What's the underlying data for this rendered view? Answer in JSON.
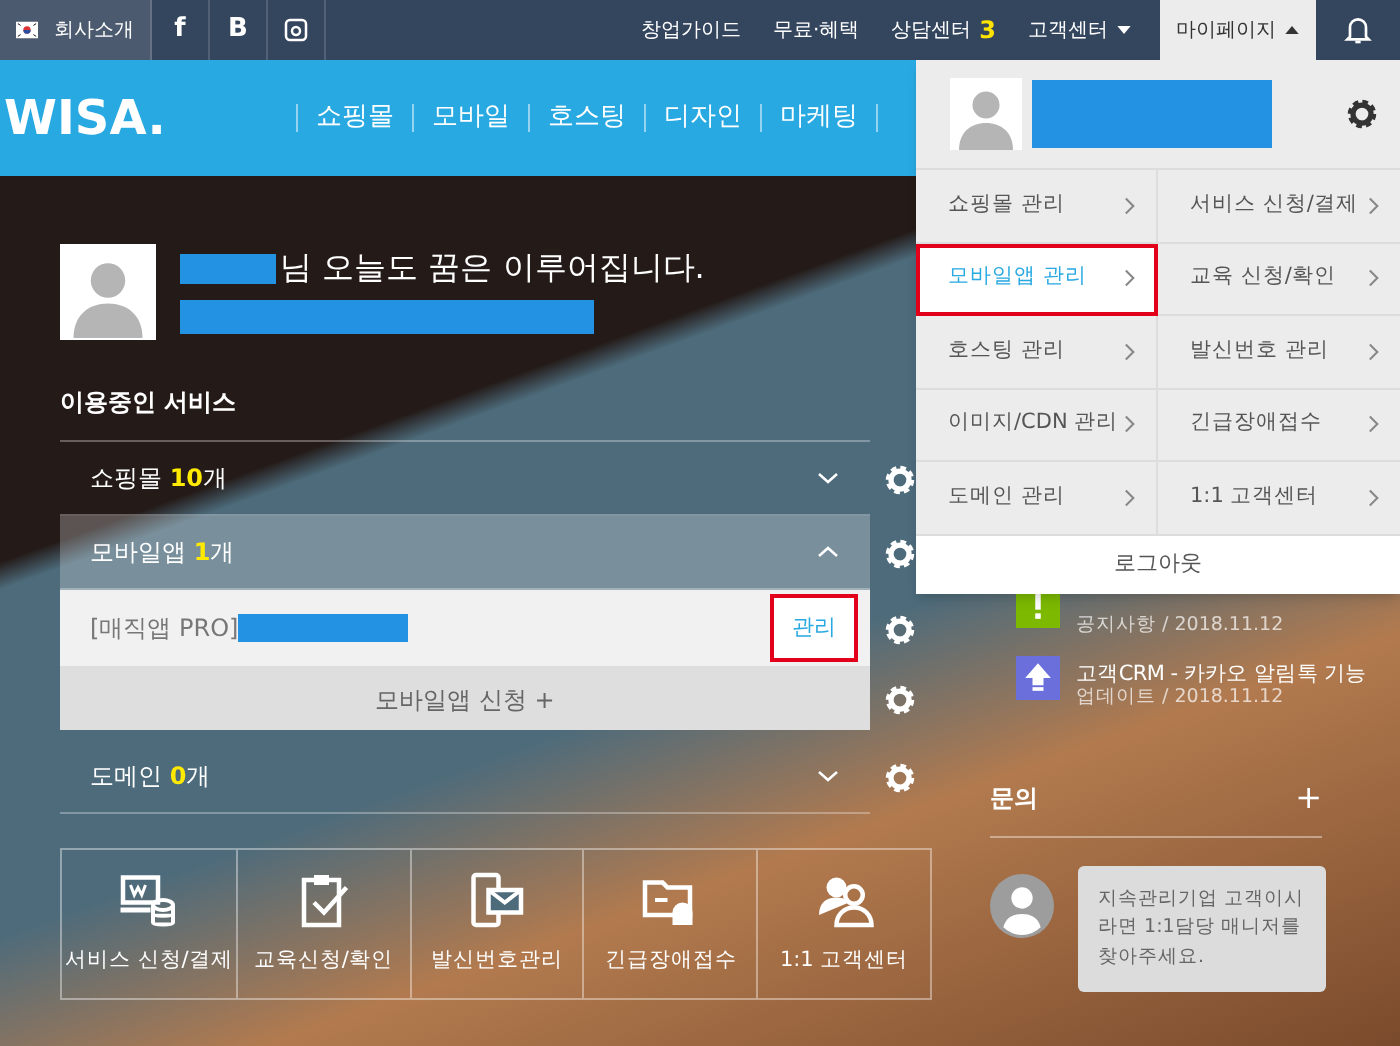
{
  "topbar": {
    "company": "회사소개",
    "social": [
      {
        "kind": "facebook",
        "label": "f"
      },
      {
        "kind": "blog",
        "label": "B"
      },
      {
        "kind": "instagram"
      }
    ],
    "links": [
      {
        "label": "창업가이드",
        "selected": false
      },
      {
        "label": "무료·혜택",
        "selected": false
      },
      {
        "label": "상담센터",
        "badge": "3",
        "selected": false
      },
      {
        "label": "고객센터",
        "expanded": false,
        "selected": false
      },
      {
        "label": "마이페이지",
        "expanded": true,
        "selected": true
      }
    ]
  },
  "header": {
    "logo": "WISA.",
    "nav": [
      "쇼핑몰",
      "모바일",
      "호스팅",
      "디자인",
      "마케팅"
    ]
  },
  "welcome": {
    "greeting": "님 오늘도 꿈은 이루어집니다."
  },
  "services": {
    "title": "이용중인 서비스",
    "rows": [
      {
        "label": "쇼핑몰",
        "count": "10",
        "unit": "개",
        "expanded": false
      },
      {
        "label": "모바일앱",
        "count": "1",
        "unit": "개",
        "expanded": true,
        "items": [
          {
            "name": "[매직앱 PRO]",
            "action": "관리",
            "highlighted": true
          }
        ],
        "apply": "모바일앱 신청 +"
      },
      {
        "label": "도메인",
        "count": "0",
        "unit": "개",
        "expanded": false
      }
    ]
  },
  "quick_links": [
    {
      "kind": "service",
      "label": "서비스 신청/결제"
    },
    {
      "kind": "education",
      "label": "교육신청/확인"
    },
    {
      "kind": "sender",
      "label": "발신번호관리"
    },
    {
      "kind": "emergency",
      "label": "긴급장애접수"
    },
    {
      "kind": "support",
      "label": "1:1 고객센터"
    }
  ],
  "news": [
    {
      "kind": "notice",
      "meta": "공지사항 / 2018.11.12"
    },
    {
      "kind": "update",
      "title": "고객CRM - 카카오 알림톡 기능",
      "meta": "업데이트 / 2018.11.12"
    }
  ],
  "inquiry": {
    "title": "문의",
    "add": "+",
    "message": "지속관리기업 고객이시라면 1:1담당 매니저를 찾아주세요."
  },
  "mypage_menu": {
    "items": [
      {
        "label": "쇼핑몰 관리",
        "highlighted": false
      },
      {
        "label": "서비스 신청/결제",
        "highlighted": false
      },
      {
        "label": "모바일앱 관리",
        "highlighted": true
      },
      {
        "label": "교육 신청/확인",
        "highlighted": false
      },
      {
        "label": "호스팅 관리",
        "highlighted": false
      },
      {
        "label": "발신번호 관리",
        "highlighted": false
      },
      {
        "label": "이미지/CDN 관리",
        "highlighted": false
      },
      {
        "label": "긴급장애접수",
        "highlighted": false
      },
      {
        "label": "도메인 관리",
        "highlighted": false
      },
      {
        "label": "1:1 고객센터",
        "highlighted": false
      }
    ],
    "logout": "로그아웃"
  }
}
